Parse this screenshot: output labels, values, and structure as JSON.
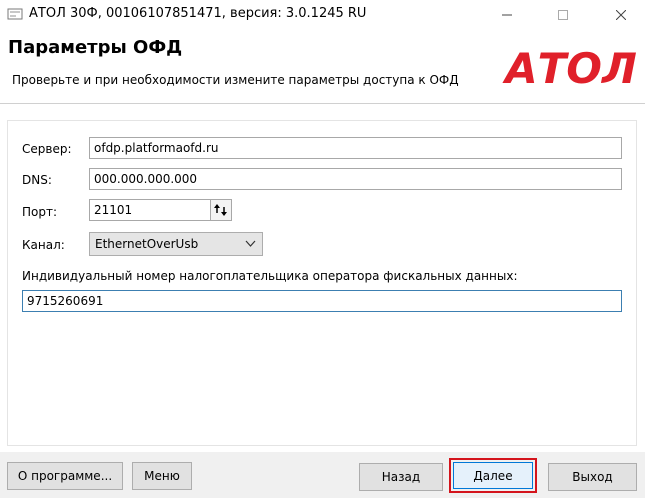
{
  "window": {
    "title": "АТОЛ 30Ф, 00106107851471, версия: 3.0.1245 RU"
  },
  "header": {
    "title": "Параметры ОФД",
    "subtitle": "Проверьте и при необходимости измените параметры доступа к ОФД",
    "logo_text": "АТОЛ",
    "logo_color": "#e0202a"
  },
  "form": {
    "server_label": "Сервер:",
    "server_value": "ofdp.platformaofd.ru",
    "dns_label": "DNS:",
    "dns_value": "000.000.000.000",
    "port_label": "Порт:",
    "port_value": "21101",
    "channel_label": "Канал:",
    "channel_value": "EthernetOverUsb",
    "inn_label": "Индивидуальный номер налогоплательщика оператора фискальных данных:",
    "inn_value": "9715260691"
  },
  "buttons": {
    "about": "О программе...",
    "menu": "Меню",
    "back": "Назад",
    "next": "Далее",
    "exit": "Выход"
  },
  "colors": {
    "highlight": "#d4141c",
    "focus": "#0078d7"
  }
}
